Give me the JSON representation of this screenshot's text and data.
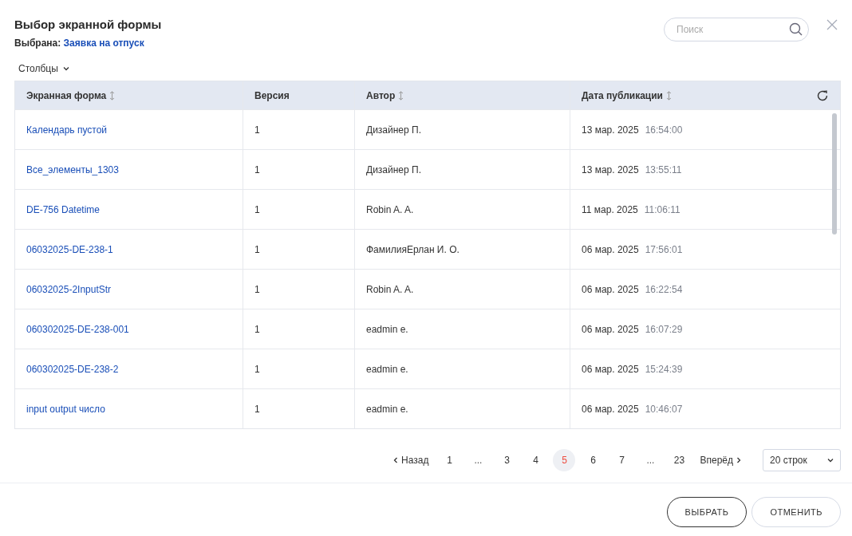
{
  "dialog": {
    "title": "Выбор экранной формы",
    "selected_label": "Выбрана:",
    "selected_value": "Заявка на отпуск"
  },
  "search": {
    "placeholder": "Поиск"
  },
  "columns_menu": {
    "label": "Столбцы"
  },
  "table": {
    "columns": [
      {
        "label": "Экранная форма",
        "sortable": true
      },
      {
        "label": "Версия",
        "sortable": false
      },
      {
        "label": "Автор",
        "sortable": true
      },
      {
        "label": "Дата публикации",
        "sortable": true
      }
    ],
    "rows": [
      {
        "form": "Календарь пустой",
        "version": "1",
        "author": "Дизайнер П.",
        "date": "13 мар. 2025",
        "time": "16:54:00"
      },
      {
        "form": "Все_элементы_1303",
        "version": "1",
        "author": "Дизайнер П.",
        "date": "13 мар. 2025",
        "time": "13:55:11"
      },
      {
        "form": "DE-756 Datetime",
        "version": "1",
        "author": "Robin A. A.",
        "date": "11 мар. 2025",
        "time": "11:06:11"
      },
      {
        "form": "06032025-DE-238-1",
        "version": "1",
        "author": "ФамилияЕрлан И. О.",
        "date": "06 мар. 2025",
        "time": "17:56:01"
      },
      {
        "form": "06032025-2InputStr",
        "version": "1",
        "author": "Robin A. A.",
        "date": "06 мар. 2025",
        "time": "16:22:54"
      },
      {
        "form": "060302025-DE-238-001",
        "version": "1",
        "author": "eadmin e.",
        "date": "06 мар. 2025",
        "time": "16:07:29"
      },
      {
        "form": "060302025-DE-238-2",
        "version": "1",
        "author": "eadmin e.",
        "date": "06 мар. 2025",
        "time": "15:24:39"
      },
      {
        "form": "input output число",
        "version": "1",
        "author": "eadmin e.",
        "date": "06 мар. 2025",
        "time": "10:46:07"
      }
    ]
  },
  "pagination": {
    "items": [
      {
        "kind": "prev",
        "label": "Назад"
      },
      {
        "kind": "page",
        "label": "1",
        "selected": false
      },
      {
        "kind": "ellipsis",
        "label": "..."
      },
      {
        "kind": "page",
        "label": "3",
        "selected": false
      },
      {
        "kind": "page",
        "label": "4",
        "selected": false
      },
      {
        "kind": "page",
        "label": "5",
        "selected": true
      },
      {
        "kind": "page",
        "label": "6",
        "selected": false
      },
      {
        "kind": "page",
        "label": "7",
        "selected": false
      },
      {
        "kind": "ellipsis",
        "label": "..."
      },
      {
        "kind": "page",
        "label": "23",
        "selected": false
      },
      {
        "kind": "next",
        "label": "Вперёд"
      }
    ],
    "page_size": "20 строк"
  },
  "buttons": [
    {
      "kind": "primary",
      "label": "ВЫБРАТЬ"
    },
    {
      "kind": "secondary",
      "label": "ОТМЕНИТЬ"
    }
  ]
}
